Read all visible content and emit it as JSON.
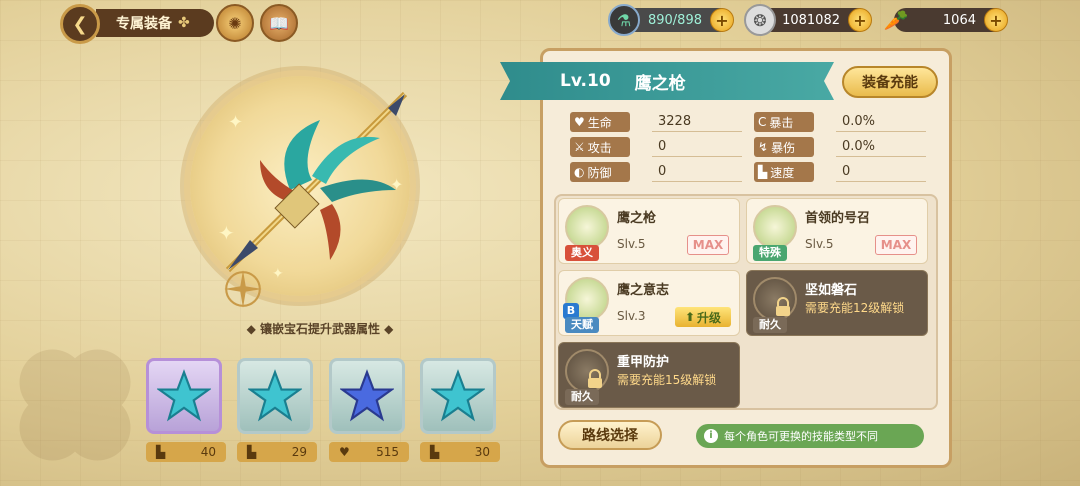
{
  "header": {
    "title": "专属装备",
    "back_icon": "back-arrow-icon",
    "resources": [
      {
        "name": "stamina",
        "value": "890/898",
        "icon": "potion-icon"
      },
      {
        "name": "coins",
        "value": "1081082",
        "icon": "coin-icon"
      },
      {
        "name": "carrot",
        "value": "1064",
        "icon": "carrot-icon"
      }
    ]
  },
  "weapon": {
    "inlay_hint": "镶嵌宝石提升武器属性"
  },
  "gems": [
    {
      "stat_icon": "boot",
      "value": "40",
      "selected": true
    },
    {
      "stat_icon": "boot",
      "value": "29",
      "selected": false
    },
    {
      "stat_icon": "heart",
      "value": "515",
      "selected": false
    },
    {
      "stat_icon": "boot",
      "value": "30",
      "selected": false
    }
  ],
  "panel": {
    "level": "Lv.10",
    "name": "鹰之枪",
    "charge_button": "装备充能",
    "stats": [
      {
        "label": "生命",
        "value": "3228"
      },
      {
        "label": "攻击",
        "value": "0"
      },
      {
        "label": "防御",
        "value": "0"
      },
      {
        "label": "暴击",
        "value": "0.0%"
      },
      {
        "label": "暴伤",
        "value": "0.0%"
      },
      {
        "label": "速度",
        "value": "0"
      }
    ],
    "skills": [
      {
        "name": "鹰之枪",
        "tag": "奥义",
        "level": "Slv.5",
        "badge": "MAX"
      },
      {
        "name": "首领的号召",
        "tag": "特殊",
        "level": "Slv.5",
        "badge": "MAX"
      },
      {
        "name": "鹰之意志",
        "tag": "天赋",
        "level": "Slv.3",
        "badge": "升级",
        "grade": "B"
      },
      {
        "name": "坚如磐石",
        "tag": "耐久",
        "unlock": "需要充能12级解锁"
      },
      {
        "name": "重甲防护",
        "tag": "耐久",
        "unlock": "需要充能15级解锁"
      }
    ],
    "route_button": "路线选择",
    "hint": "每个角色可更换的技能类型不同"
  },
  "colors": {
    "ribbon": "#2f8c8c",
    "panel_bg": "#f6ecd9",
    "max_badge": "#e6908a",
    "hint_bg": "#6aa654"
  }
}
